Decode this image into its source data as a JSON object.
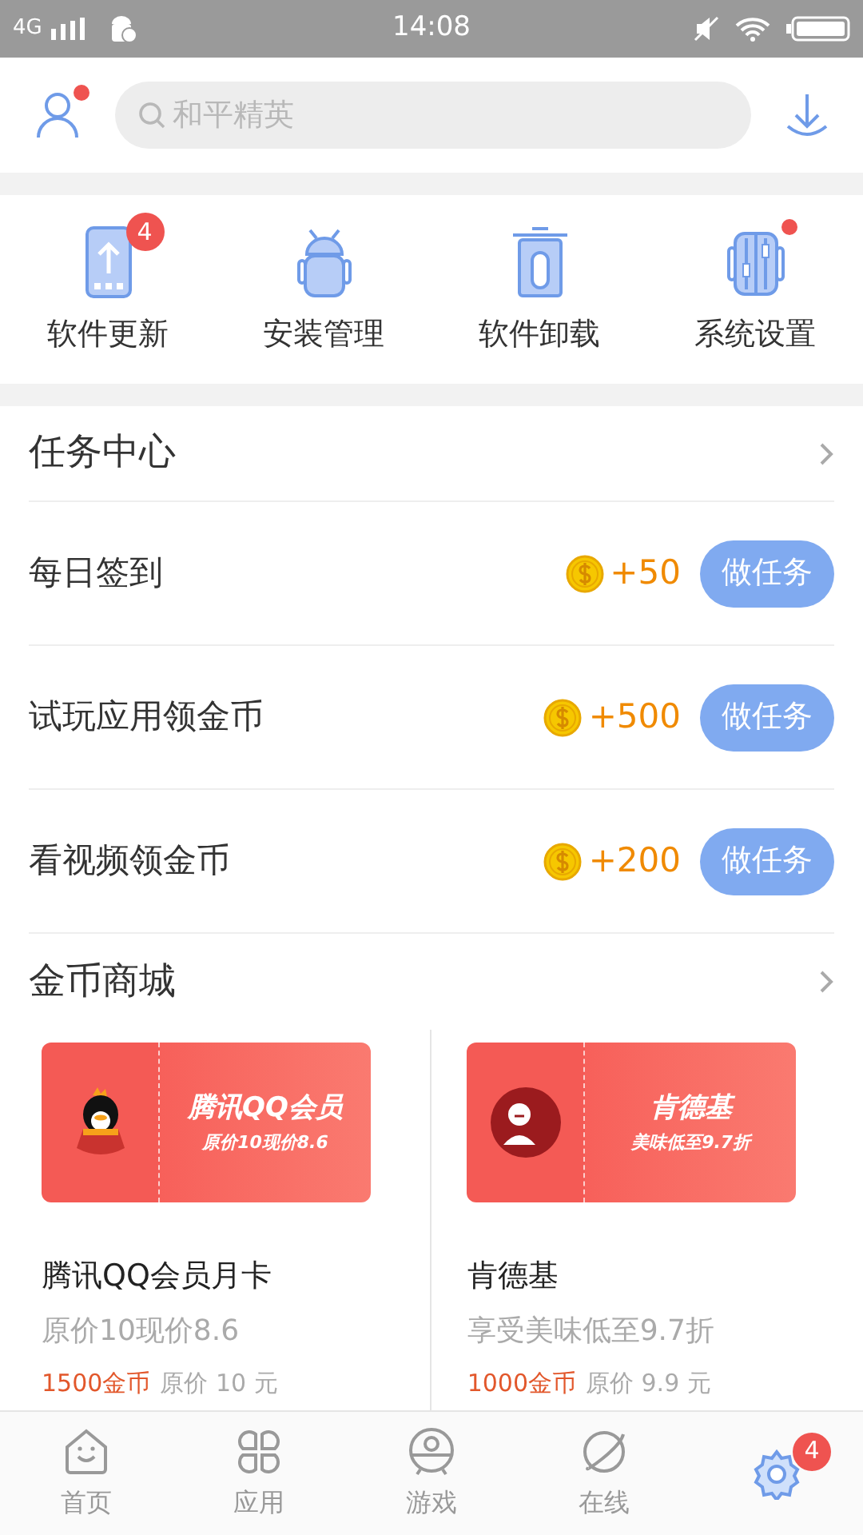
{
  "status_bar": {
    "network": "4G",
    "time": "14:08"
  },
  "search": {
    "placeholder": "和平精英"
  },
  "profile": {
    "notification_dot": true
  },
  "shortcuts": [
    {
      "kind": "update",
      "label": "软件更新",
      "badge": "4",
      "dot": false
    },
    {
      "kind": "install",
      "label": "安装管理",
      "dot": false
    },
    {
      "kind": "uninstall",
      "label": "软件卸载",
      "dot": false
    },
    {
      "kind": "settings",
      "label": "系统设置",
      "dot": true
    }
  ],
  "task_center": {
    "title": "任务中心",
    "tasks": [
      {
        "label": "每日签到",
        "reward": "+50",
        "button": "做任务"
      },
      {
        "label": "试玩应用领金币",
        "reward": "+500",
        "button": "做任务"
      },
      {
        "label": "看视频领金币",
        "reward": "+200",
        "button": "做任务"
      }
    ]
  },
  "coin_store": {
    "title": "金币商城",
    "items": [
      {
        "kind": "qq",
        "coupon_title": "腾讯QQ会员",
        "coupon_subtitle": "原价10现价8.6",
        "name": "腾讯QQ会员月卡",
        "description": "原价10现价8.6",
        "coins": "1500金币",
        "original_price": "原价 10 元"
      },
      {
        "kind": "kfc",
        "coupon_title": "肯德基",
        "coupon_subtitle": "美味低至9.7折",
        "name": "肯德基",
        "description": "享受美味低至9.7折",
        "coins": "1000金币",
        "original_price": "原价 9.9 元"
      }
    ]
  },
  "bottom_nav": [
    {
      "kind": "home",
      "label": "首页",
      "selected": false
    },
    {
      "kind": "apps",
      "label": "应用",
      "selected": false
    },
    {
      "kind": "games",
      "label": "游戏",
      "selected": false
    },
    {
      "kind": "online",
      "label": "在线",
      "selected": false
    },
    {
      "kind": "manage",
      "selected": true,
      "badge": "4"
    }
  ]
}
